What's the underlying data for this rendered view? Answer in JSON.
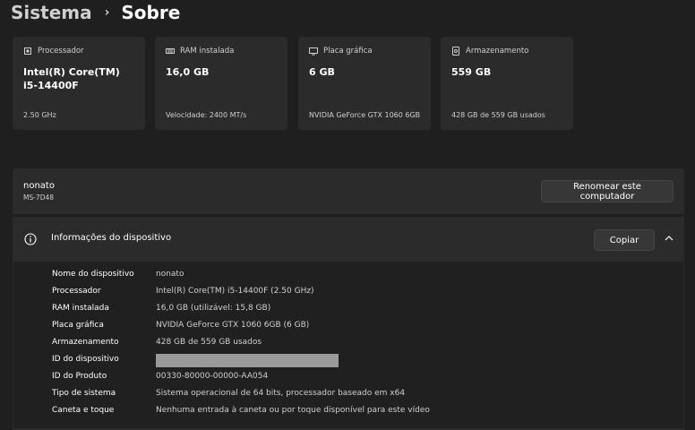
{
  "breadcrumb": {
    "parent": "Sistema",
    "separator": "›",
    "current": "Sobre"
  },
  "specs": [
    {
      "icon": "processor-icon",
      "label": "Processador",
      "value": "Intel(R) Core(TM)\ni5-14400F",
      "sub": "2.50 GHz"
    },
    {
      "icon": "ram-icon",
      "label": "RAM instalada",
      "value": "16,0 GB",
      "sub": "Velocidade: 2400 MT/s"
    },
    {
      "icon": "gpu-icon",
      "label": "Placa gráfica",
      "value": "6 GB",
      "sub": "NVIDIA GeForce GTX 1060 6GB"
    },
    {
      "icon": "storage-icon",
      "label": "Armazenamento",
      "value": "559 GB",
      "sub": "428 GB de 559 GB usados"
    }
  ],
  "computer": {
    "name": "nonato",
    "model": "MS-7D48",
    "rename_label": "Renomear este computador"
  },
  "device_info": {
    "title": "Informações do dispositivo",
    "copy_label": "Copiar",
    "rows": [
      {
        "label": "Nome do dispositivo",
        "value": "nonato"
      },
      {
        "label": "Processador",
        "value": "Intel(R) Core(TM) i5-14400F (2.50 GHz)"
      },
      {
        "label": "RAM instalada",
        "value": "16,0 GB (utilizável: 15,8 GB)"
      },
      {
        "label": "Placa gráfica",
        "value": "NVIDIA GeForce GTX 1060 6GB (6 GB)"
      },
      {
        "label": "Armazenamento",
        "value": "428 GB de 559 GB usados"
      },
      {
        "label": "ID do dispositivo",
        "value": ""
      },
      {
        "label": "ID do Produto",
        "value": "00330-80000-00000-AA054"
      },
      {
        "label": "Tipo de sistema",
        "value": "Sistema operacional de 64 bits, processador baseado em x64"
      },
      {
        "label": "Caneta e toque",
        "value": "Nenhuma entrada à caneta ou por toque disponível para este vídeo"
      }
    ]
  },
  "colors": {
    "background": "#1f1f1f",
    "card": "#2b2b2b",
    "redacted": "#9a9a9a"
  }
}
